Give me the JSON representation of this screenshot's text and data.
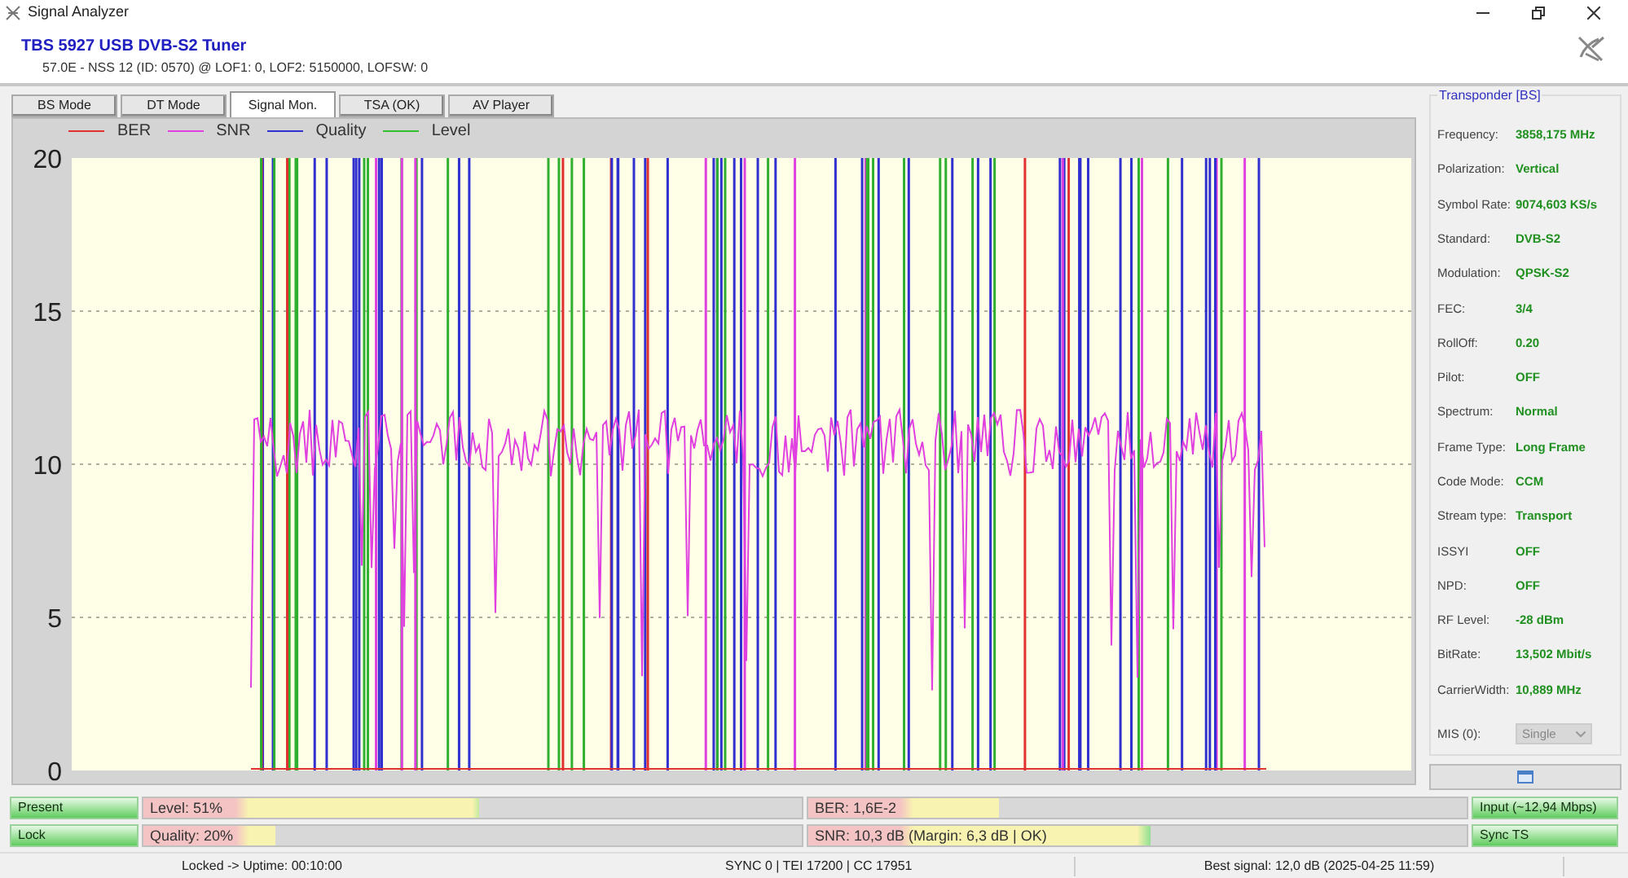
{
  "window": {
    "title": "Signal Analyzer"
  },
  "header": {
    "title": "TBS 5927 USB DVB-S2 Tuner",
    "subtitle": "57.0E - NSS 12 (ID: 0570) @ LOF1: 0, LOF2: 5150000, LOFSW: 0"
  },
  "tabs": [
    {
      "label": "BS Mode",
      "selected": false
    },
    {
      "label": "DT Mode",
      "selected": false
    },
    {
      "label": "Signal Mon.",
      "selected": true
    },
    {
      "label": "TSA (OK)",
      "selected": false
    },
    {
      "label": "AV Player",
      "selected": false
    }
  ],
  "chart": {
    "legend": [
      {
        "label": "BER",
        "color": "#e03030"
      },
      {
        "label": "SNR",
        "color": "#e040e0"
      },
      {
        "label": "Quality",
        "color": "#3030d0"
      },
      {
        "label": "Level",
        "color": "#30c030"
      }
    ],
    "y_axis_labels": [
      "20",
      "15",
      "10",
      "5",
      "0"
    ]
  },
  "transponder": {
    "title": "Transponder [BS]",
    "fields": [
      {
        "label": "Frequency:",
        "value": "3858,175 MHz"
      },
      {
        "label": "Polarization:",
        "value": "Vertical"
      },
      {
        "label": "Symbol Rate:",
        "value": "9074,603 KS/s"
      },
      {
        "label": "Standard:",
        "value": "DVB-S2"
      },
      {
        "label": "Modulation:",
        "value": "QPSK-S2"
      },
      {
        "label": "FEC:",
        "value": "3/4"
      },
      {
        "label": "RollOff:",
        "value": "0.20"
      },
      {
        "label": "Pilot:",
        "value": "OFF"
      },
      {
        "label": "Spectrum:",
        "value": "Normal"
      },
      {
        "label": "Frame Type:",
        "value": "Long Frame"
      },
      {
        "label": "Code Mode:",
        "value": "CCM"
      },
      {
        "label": "Stream type:",
        "value": "Transport"
      },
      {
        "label": "ISSYI",
        "value": "OFF"
      },
      {
        "label": "NPD:",
        "value": "OFF"
      },
      {
        "label": "RF Level:",
        "value": "-28 dBm"
      },
      {
        "label": "BitRate:",
        "value": "13,502 Mbit/s"
      },
      {
        "label": "CarrierWidth:",
        "value": "10,889 MHz"
      }
    ],
    "mis": {
      "label": "MIS (0):",
      "value": "Single",
      "disabled": true
    }
  },
  "meters": [
    {
      "indicator": {
        "label": "Present",
        "on": true
      },
      "bars": [
        {
          "label": "Level: 51%",
          "level": 0.51
        },
        {
          "label": "BER: 1,6E-2",
          "level": 0.29
        }
      ],
      "status": {
        "label": "Input (~12,94 Mbps)",
        "on": true
      }
    },
    {
      "indicator": {
        "label": "Lock",
        "on": true
      },
      "bars": [
        {
          "label": "Quality: 20%",
          "level": 0.2
        },
        {
          "label": "SNR: 10,3 dB (Margin: 6,3 dB | OK)",
          "level": 0.52
        }
      ],
      "status": {
        "label": "Sync TS",
        "on": true
      }
    }
  ],
  "status_bar": {
    "uptime": "Locked -> Uptime: 00:10:00",
    "counters": "SYNC 0 | TEI 17200 | CC 17951",
    "best_signal": "Best signal: 12,0 dB (2025-04-25 11:59)"
  }
}
